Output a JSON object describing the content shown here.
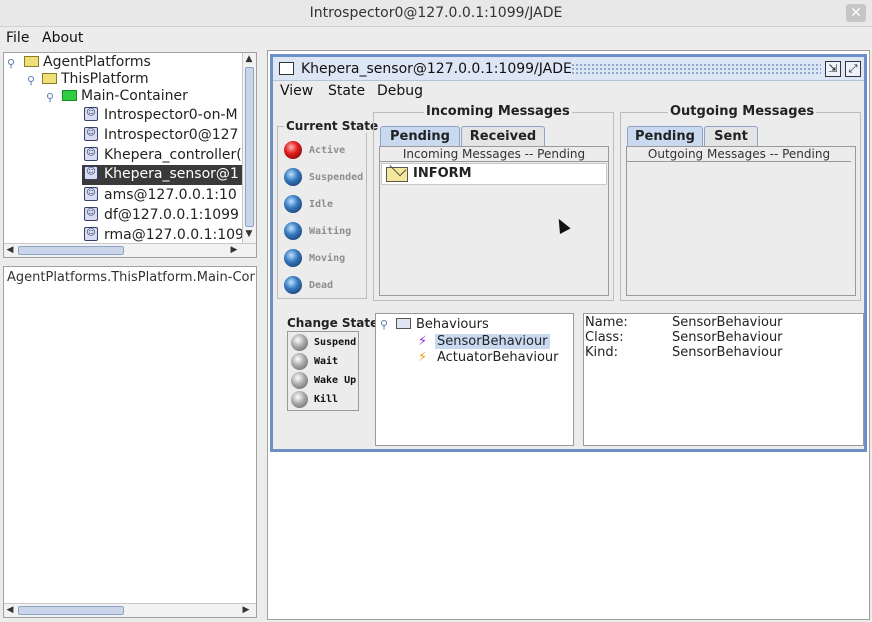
{
  "window": {
    "title": "Introspector0@127.0.0.1:1099/JADE",
    "close_glyph": "✕"
  },
  "menubar": {
    "file": "File",
    "about": "About"
  },
  "tree": {
    "nodes": [
      {
        "label": "AgentPlatforms",
        "icon": "folder-icon"
      },
      {
        "label": "ThisPlatform",
        "icon": "folder-icon"
      },
      {
        "label": "Main-Container",
        "icon": "container-icon"
      },
      {
        "label": "Introspector0-on-M",
        "icon": "agent-icon"
      },
      {
        "label": "Introspector0@127",
        "icon": "agent-icon"
      },
      {
        "label": "Khepera_controller(",
        "icon": "agent-icon"
      },
      {
        "label": "Khepera_sensor@1",
        "icon": "agent-icon",
        "selected": true
      },
      {
        "label": "ams@127.0.0.1:10",
        "icon": "agent-icon"
      },
      {
        "label": "df@127.0.0.1:1099",
        "icon": "agent-icon"
      },
      {
        "label": "rma@127.0.0.1:109",
        "icon": "agent-icon"
      }
    ]
  },
  "path_text": "AgentPlatforms.ThisPlatform.Main-Conta",
  "agent_frame": {
    "title": "Khepera_sensor@127.0.0.1:1099/JADE",
    "menu": {
      "view": "View",
      "state": "State",
      "debug": "Debug"
    },
    "current_state": {
      "title": "Current State",
      "states": [
        {
          "label": "Active",
          "color": "red"
        },
        {
          "label": "Suspended",
          "color": "blue"
        },
        {
          "label": "Idle",
          "color": "blue"
        },
        {
          "label": "Waiting",
          "color": "blue"
        },
        {
          "label": "Moving",
          "color": "blue"
        },
        {
          "label": "Dead",
          "color": "blue"
        }
      ]
    },
    "change_state": {
      "title": "Change State",
      "buttons": [
        "Suspend",
        "Wait",
        "Wake Up",
        "Kill"
      ]
    },
    "incoming": {
      "title": "Incoming Messages",
      "tabs": [
        "Pending",
        "Received"
      ],
      "list_header": "Incoming Messages -- Pending",
      "messages": [
        "INFORM"
      ]
    },
    "outgoing": {
      "title": "Outgoing Messages",
      "tabs": [
        "Pending",
        "Sent"
      ],
      "list_header": "Outgoing Messages -- Pending"
    },
    "behaviours": {
      "root": "Behaviours",
      "items": [
        "SensorBehaviour",
        "ActuatorBehaviour"
      ],
      "selected": "SensorBehaviour"
    },
    "properties": {
      "name_label": "Name:",
      "name_value": "SensorBehaviour",
      "class_label": "Class:",
      "class_value": "SensorBehaviour",
      "kind_label": "Kind:",
      "kind_value": "SensorBehaviour"
    }
  },
  "colors": {
    "frame_border": "#6d8fc7",
    "selection": "#3a3a3a",
    "behaviour_selection": "#c9daf0"
  }
}
